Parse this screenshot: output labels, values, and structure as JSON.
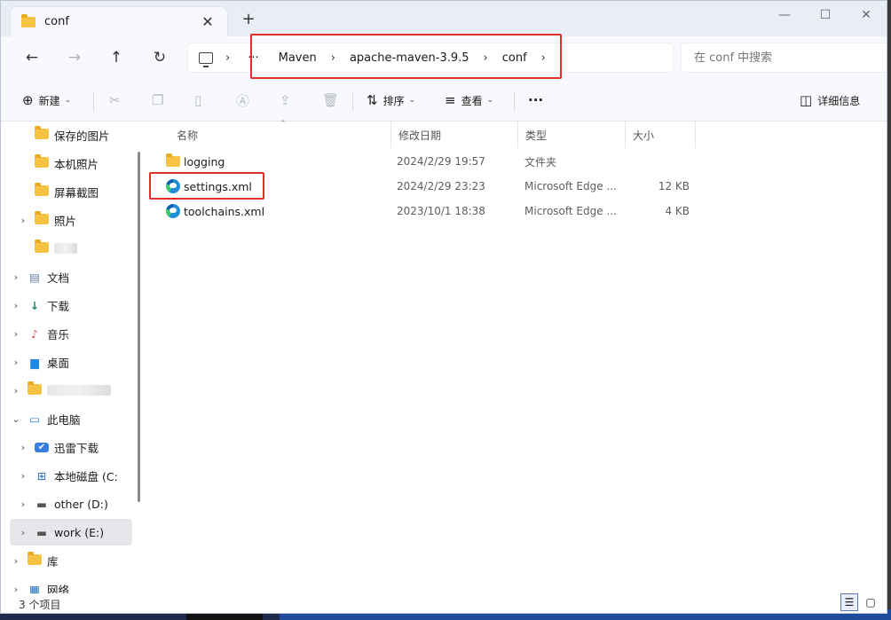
{
  "window": {
    "tab_title": "conf",
    "close_tab": "✕",
    "new_tab": "+",
    "controls": {
      "minimize": "—",
      "maximize": "☐",
      "close": "✕"
    }
  },
  "nav": {
    "back": "←",
    "forward": "→",
    "up": "↑",
    "refresh": "↻",
    "more": "···",
    "breadcrumbs": [
      "Maven",
      "apache-maven-3.9.5",
      "conf"
    ],
    "search_placeholder": "在 conf 中搜索"
  },
  "commands": {
    "new": "新建",
    "sort": "排序",
    "view": "查看",
    "more": "···",
    "details": "详细信息"
  },
  "sidebar": {
    "items": [
      {
        "label": "保存的图片",
        "icon": "folder-icon",
        "level": 2
      },
      {
        "label": "本机照片",
        "icon": "folder-icon",
        "level": 2
      },
      {
        "label": "屏幕截图",
        "icon": "folder-icon",
        "level": 2
      },
      {
        "label": "照片",
        "icon": "folder-icon",
        "level": 2
      },
      {
        "label": "文档",
        "icon": "document-icon",
        "level": 1
      },
      {
        "label": "下载",
        "icon": "download-icon",
        "level": 1
      },
      {
        "label": "音乐",
        "icon": "music-icon",
        "level": 1
      },
      {
        "label": "桌面",
        "icon": "desktop-icon",
        "level": 1
      },
      {
        "label": "此电脑",
        "icon": "computer-icon",
        "level": 1
      },
      {
        "label": "迅雷下载",
        "icon": "thunder-icon",
        "level": 2
      },
      {
        "label": "本地磁盘 (C:",
        "icon": "windows-drive-icon",
        "level": 2
      },
      {
        "label": "other (D:)",
        "icon": "drive-icon",
        "level": 2
      },
      {
        "label": "work (E:)",
        "icon": "drive-icon",
        "level": 2,
        "selected": true
      },
      {
        "label": "库",
        "icon": "library-icon",
        "level": 1
      },
      {
        "label": "网络",
        "icon": "network-icon",
        "level": 1
      }
    ]
  },
  "columns": {
    "name": "名称",
    "modified": "修改日期",
    "type": "类型",
    "size": "大小"
  },
  "files": [
    {
      "name": "logging",
      "modified": "2024/2/29 19:57",
      "type": "文件夹",
      "size": "",
      "icon": "folder-icon"
    },
    {
      "name": "settings.xml",
      "modified": "2024/2/29 23:23",
      "type": "Microsoft Edge ...",
      "size": "12 KB",
      "icon": "edge-icon"
    },
    {
      "name": "toolchains.xml",
      "modified": "2023/10/1 18:38",
      "type": "Microsoft Edge ...",
      "size": "4 KB",
      "icon": "edge-icon"
    }
  ],
  "status": {
    "count": "3 个项目"
  }
}
